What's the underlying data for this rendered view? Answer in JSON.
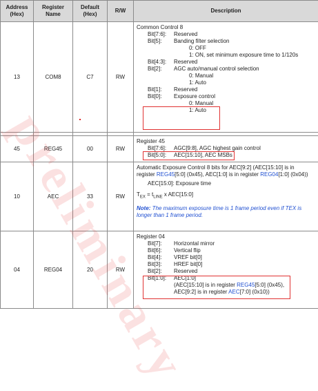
{
  "headers": {
    "address": "Address\n(Hex)",
    "register": "Register\nName",
    "default": "Default\n(Hex)",
    "rw": "R/W",
    "description": "Description"
  },
  "watermark": "preliminary",
  "rows": {
    "com8": {
      "address": "13",
      "name": "COM8",
      "default": "C7",
      "rw": "RW",
      "title": "Common Control 8",
      "bits": [
        {
          "bit": "Bit[7:6]:",
          "text": "Reserved"
        },
        {
          "bit": "Bit[5]:",
          "text": "Banding filter selection"
        },
        {
          "sub": "0:   OFF"
        },
        {
          "sub": "1:   ON, set minimum exposure time to 1/120s"
        },
        {
          "bit": "Bit[4:3]:",
          "text": "Reserved"
        },
        {
          "bit": "Bit[2]:",
          "text": "AGC auto/manual control selection"
        },
        {
          "sub": "0:   Manual"
        },
        {
          "sub": "1:   Auto"
        },
        {
          "bit": "Bit[1]:",
          "text": "Reserved"
        },
        {
          "bit": "Bit[0]:",
          "text": "Exposure control"
        },
        {
          "sub": "0:   Manual"
        },
        {
          "sub": "1:   Auto"
        }
      ]
    },
    "reg45": {
      "address": "45",
      "name": "REG45",
      "default": "00",
      "rw": "RW",
      "title": "Register 45",
      "bits": [
        {
          "bit": "Bit[7:6]:",
          "text": "AGC[9:8], AGC highest gain control"
        },
        {
          "bit": "Bit[5:0]:",
          "text": "AEC[15:10], AEC MSBs"
        }
      ]
    },
    "aec": {
      "address": "10",
      "name": "AEC",
      "default": "33",
      "rw": "RW",
      "line1_a": "Automatic Exposure Control 8 bits for AEC[9:2] (AEC[15:10] is in",
      "line2_a": "register ",
      "line2_b": "REG45",
      "line2_c": "[5:0] (0x45), AEC[1:0] is in register ",
      "line2_d": "REG04",
      "line2_e": "[1:0] (0x04))",
      "line3": "AEC[15:0]: Exposure time",
      "formula": "T",
      "formula_sub1": "EX",
      "formula_mid": " = t",
      "formula_sub2": "LINE",
      "formula_end": " x AEC[15:0]",
      "note_label": "Note:",
      "note_text": " The maximum exposure time is 1 frame period even if TEX is",
      "note_text2": "longer than 1 frame period."
    },
    "reg04": {
      "address": "04",
      "name": "REG04",
      "default": "20",
      "rw": "RW",
      "title": "Register 04",
      "bits": [
        {
          "bit": "Bit[7]:",
          "text": "Horizontal mirror"
        },
        {
          "bit": "Bit[6]:",
          "text": "Vertical flip"
        },
        {
          "bit": "Bit[4]:",
          "text": "VREF bit[0]"
        },
        {
          "bit": "Bit[3]:",
          "text": "HREF bit[0]"
        },
        {
          "bit": "Bit[2]:",
          "text": "Reserved"
        }
      ],
      "last_bit": "Bit[1:0]:",
      "last_text": "AEC[1:0]",
      "last_line2_a": "(AEC[15:10] is in register ",
      "last_line2_b": "REG45",
      "last_line2_c": "[5:0] (0x45),",
      "last_line3_a": "AEC[9:2] is in register ",
      "last_line3_b": "AEC",
      "last_line3_c": "[7:0] (0x10))"
    }
  },
  "colors": {
    "highlight_box": "#e03030",
    "link": "#1f4fd1",
    "header_bg": "#d9d9d9"
  }
}
